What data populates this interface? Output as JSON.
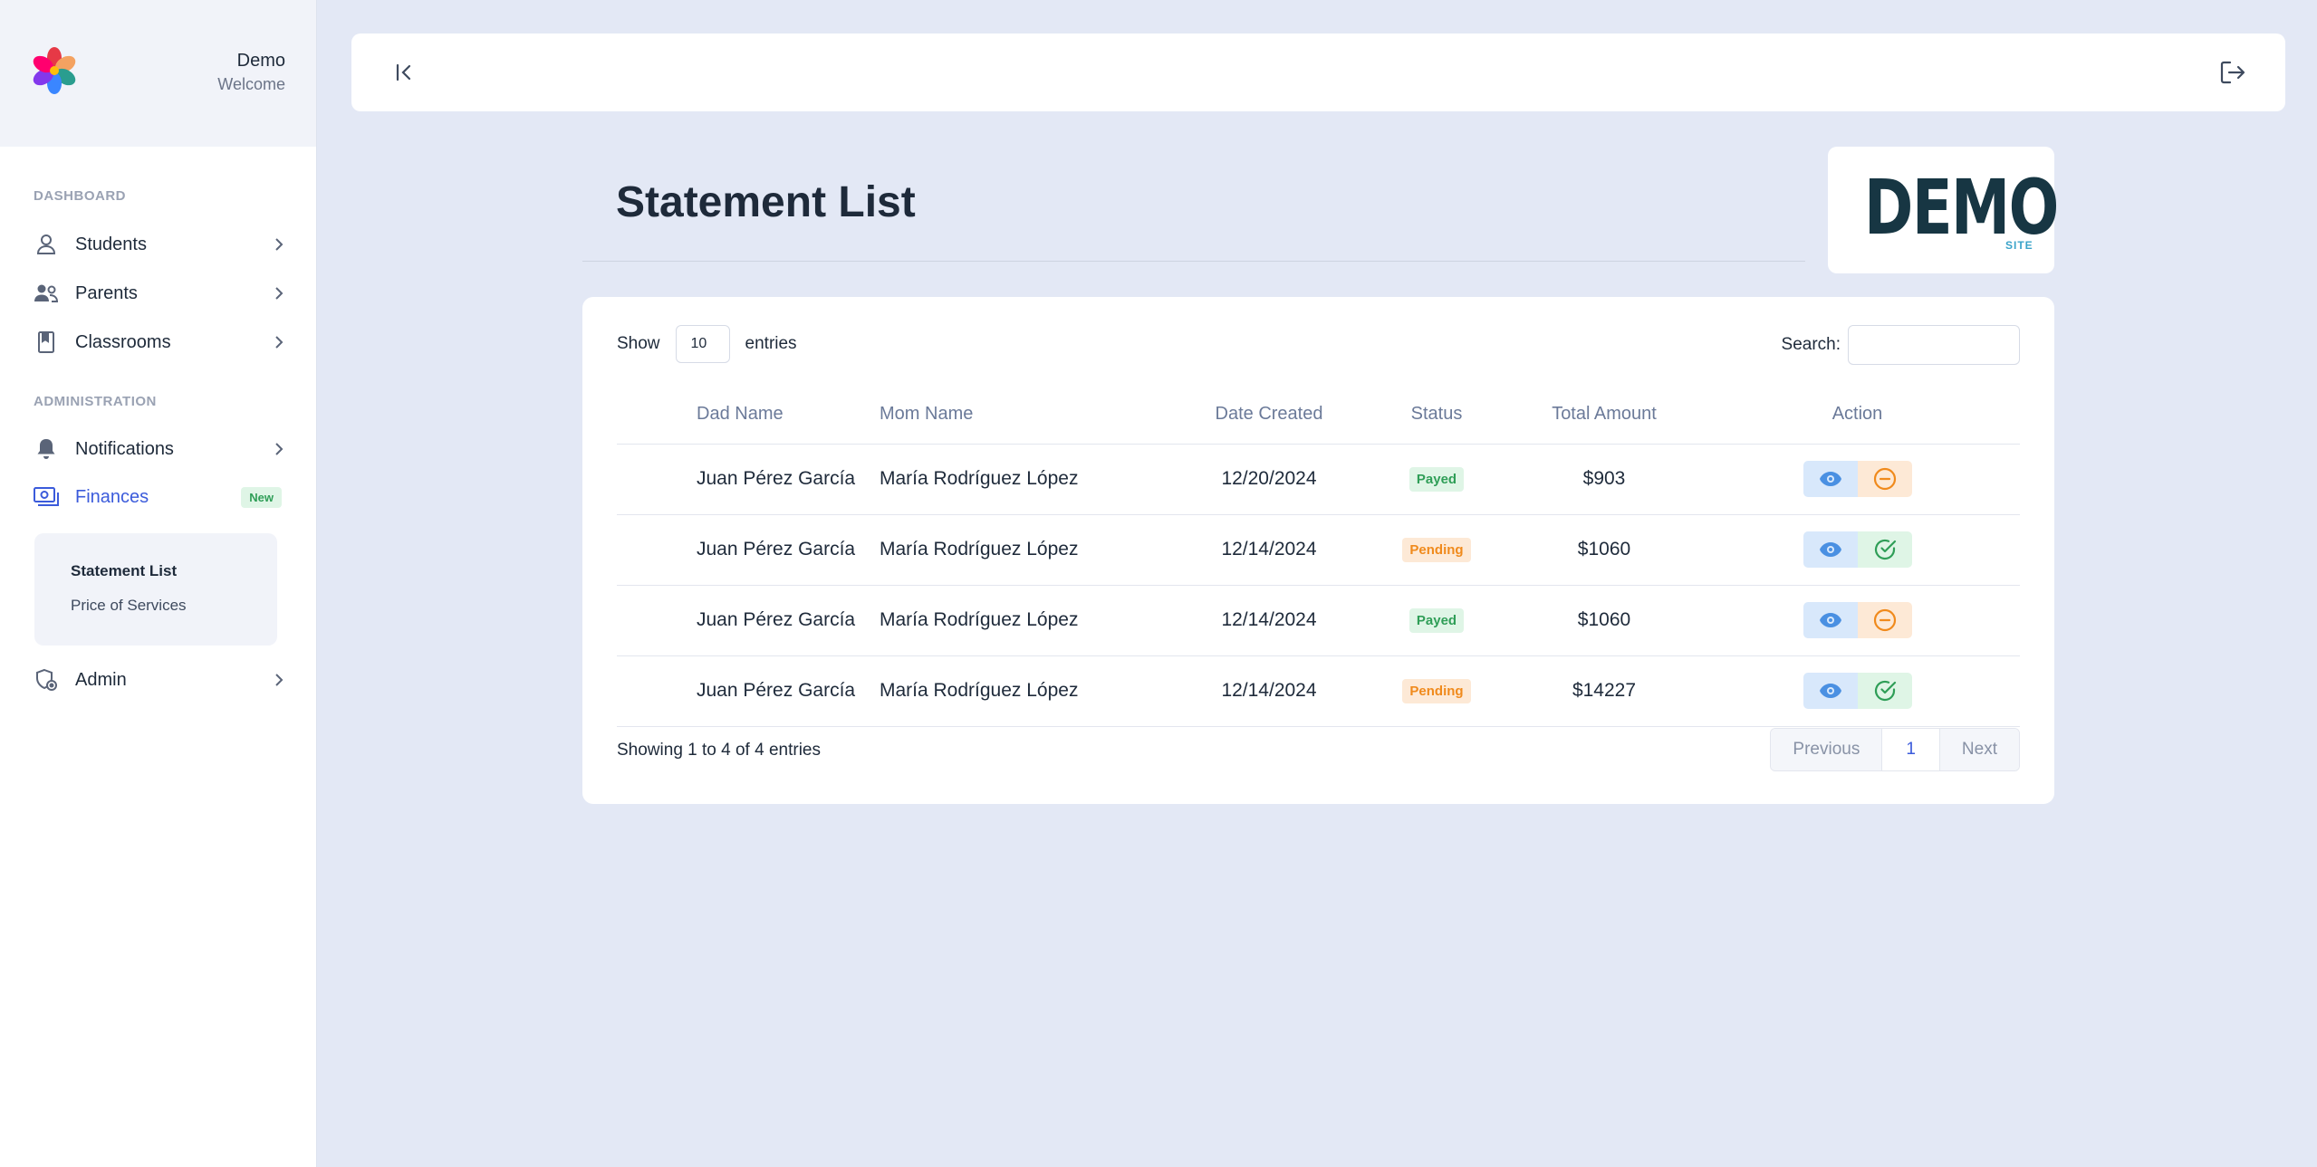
{
  "user": {
    "name": "Demo",
    "subtitle": "Welcome"
  },
  "sidebar": {
    "sections": [
      "DASHBOARD",
      "ADMINISTRATION"
    ],
    "items": [
      {
        "label": "Students",
        "icon": "user-icon"
      },
      {
        "label": "Parents",
        "icon": "users-icon"
      },
      {
        "label": "Classrooms",
        "icon": "book-icon"
      },
      {
        "label": "Notifications",
        "icon": "bell-icon"
      },
      {
        "label": "Finances",
        "icon": "money-icon",
        "badge": "New"
      },
      {
        "label": "Admin",
        "icon": "shield-icon"
      }
    ],
    "submenu": [
      "Statement List",
      "Price of Services"
    ]
  },
  "page": {
    "title": "Statement List"
  },
  "brand": {
    "main": "DEMO",
    "sub": "SITE"
  },
  "table": {
    "show_label": "Show",
    "entries_value": "10",
    "entries_label": "entries",
    "search_label": "Search:",
    "columns": [
      "Dad Name",
      "Mom Name",
      "Date Created",
      "Status",
      "Total Amount",
      "Action"
    ],
    "rows": [
      {
        "dad": "Juan Pérez García",
        "mom": "María Rodríguez López",
        "date": "12/20/2024",
        "status": "Payed",
        "amount": "$903"
      },
      {
        "dad": "Juan Pérez García",
        "mom": "María Rodríguez López",
        "date": "12/14/2024",
        "status": "Pending",
        "amount": "$1060"
      },
      {
        "dad": "Juan Pérez García",
        "mom": "María Rodríguez López",
        "date": "12/14/2024",
        "status": "Payed",
        "amount": "$1060"
      },
      {
        "dad": "Juan Pérez García",
        "mom": "María Rodríguez López",
        "date": "12/14/2024",
        "status": "Pending",
        "amount": "$14227"
      }
    ],
    "info": "Showing 1 to 4 of 4 entries",
    "pager": {
      "prev": "Previous",
      "current": "1",
      "next": "Next"
    }
  },
  "colors": {
    "accent": "#3b5bdb",
    "payed": "#2f9e57",
    "pending": "#f08a1c",
    "view": "#4a90e2"
  }
}
